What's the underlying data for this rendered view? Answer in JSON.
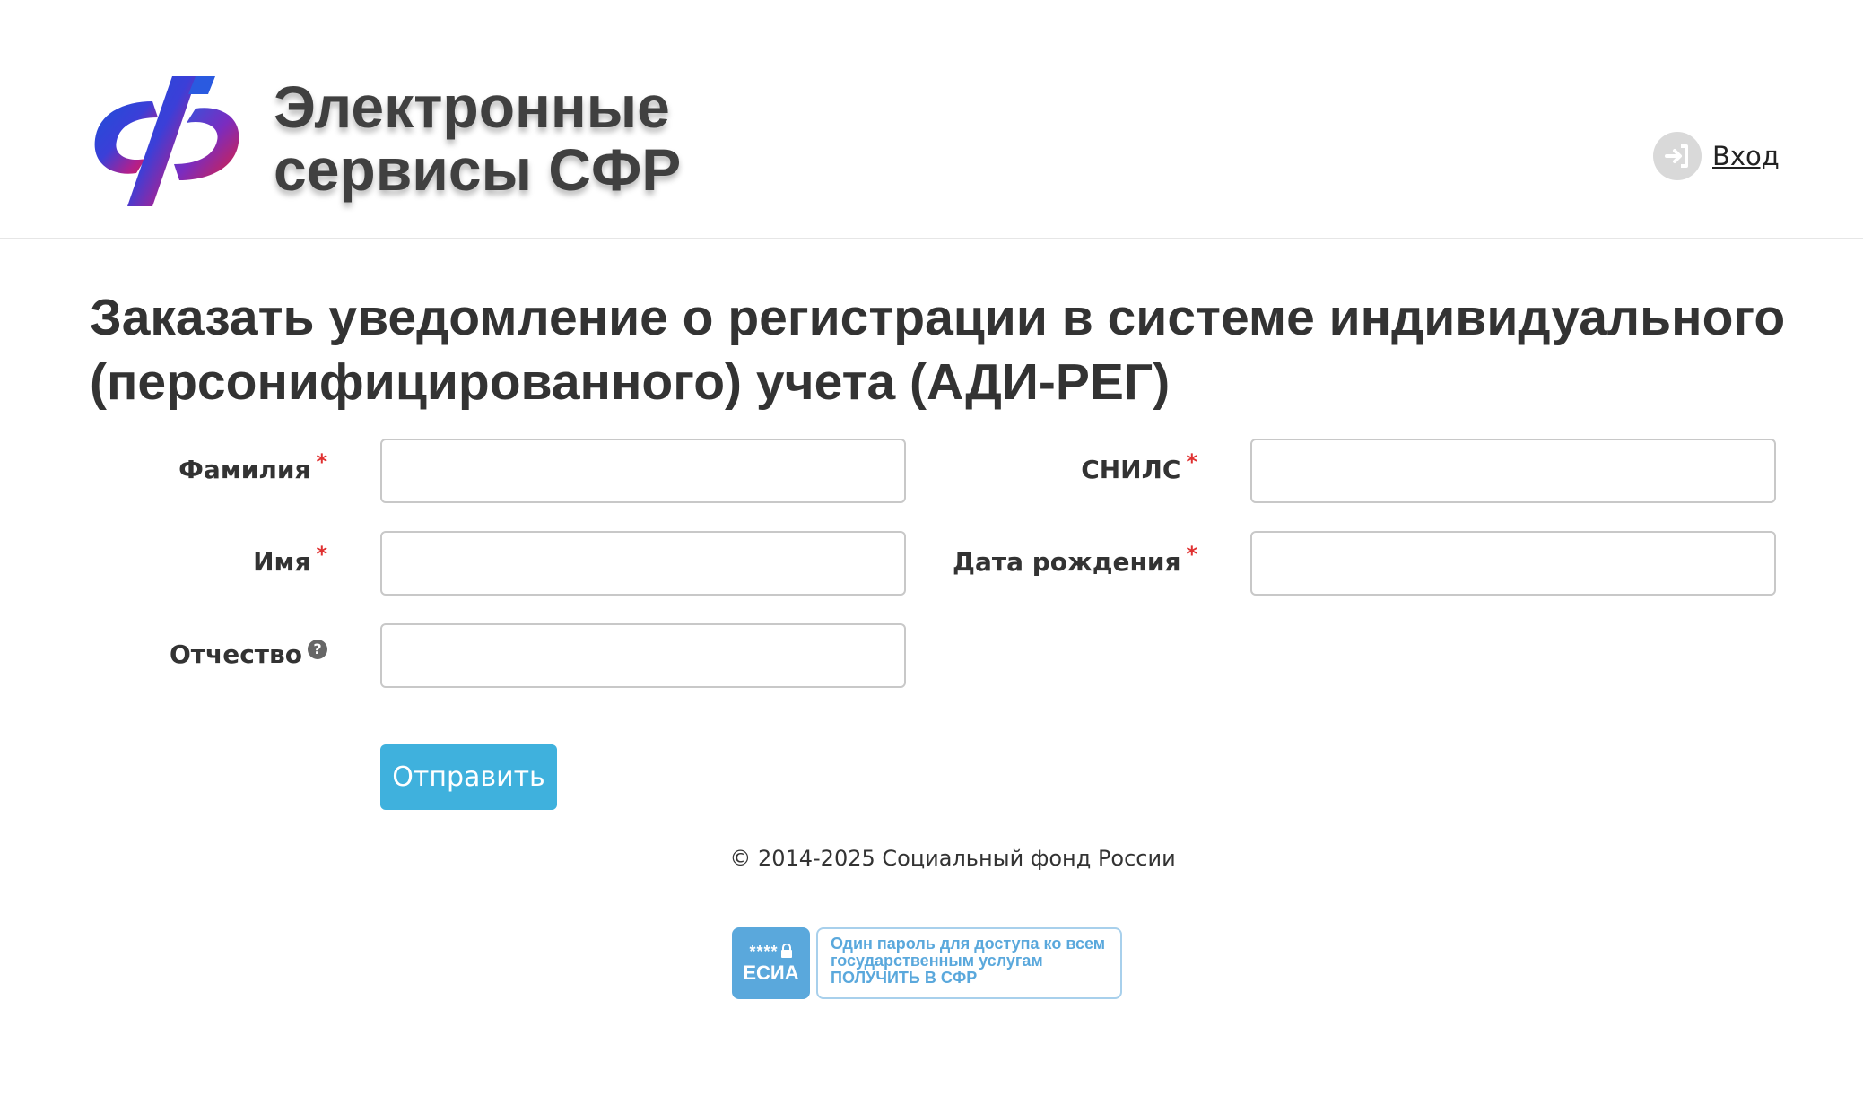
{
  "header": {
    "brand_line1": "Электронные",
    "brand_line2": "сервисы СФР",
    "login_label": "Вход",
    "logo_colors": [
      "#1e4fd8",
      "#e0203a"
    ]
  },
  "page": {
    "title": "Заказать уведомление о регистрации в системе индивидуального (персонифицированного) учета (АДИ-РЕГ)"
  },
  "form": {
    "required_mark": "*",
    "help_mark": "?",
    "fields": {
      "surname": {
        "label": "Фамилия",
        "value": ""
      },
      "name": {
        "label": "Имя",
        "value": ""
      },
      "patronymic": {
        "label": "Отчество",
        "value": ""
      },
      "snils": {
        "label": "СНИЛС",
        "value": ""
      },
      "birthdate": {
        "label": "Дата рождения",
        "value": ""
      }
    },
    "submit_label": "Отправить",
    "accent_color": "#3fb1dd"
  },
  "footer": {
    "copyright": "© 2014-2025 Социальный фонд России",
    "esia": {
      "stars": "****",
      "badge": "ЕСИА",
      "line1": "Один пароль для доступа ко всем",
      "line2": "государственным услугам",
      "line3": "ПОЛУЧИТЬ В СФР"
    }
  }
}
